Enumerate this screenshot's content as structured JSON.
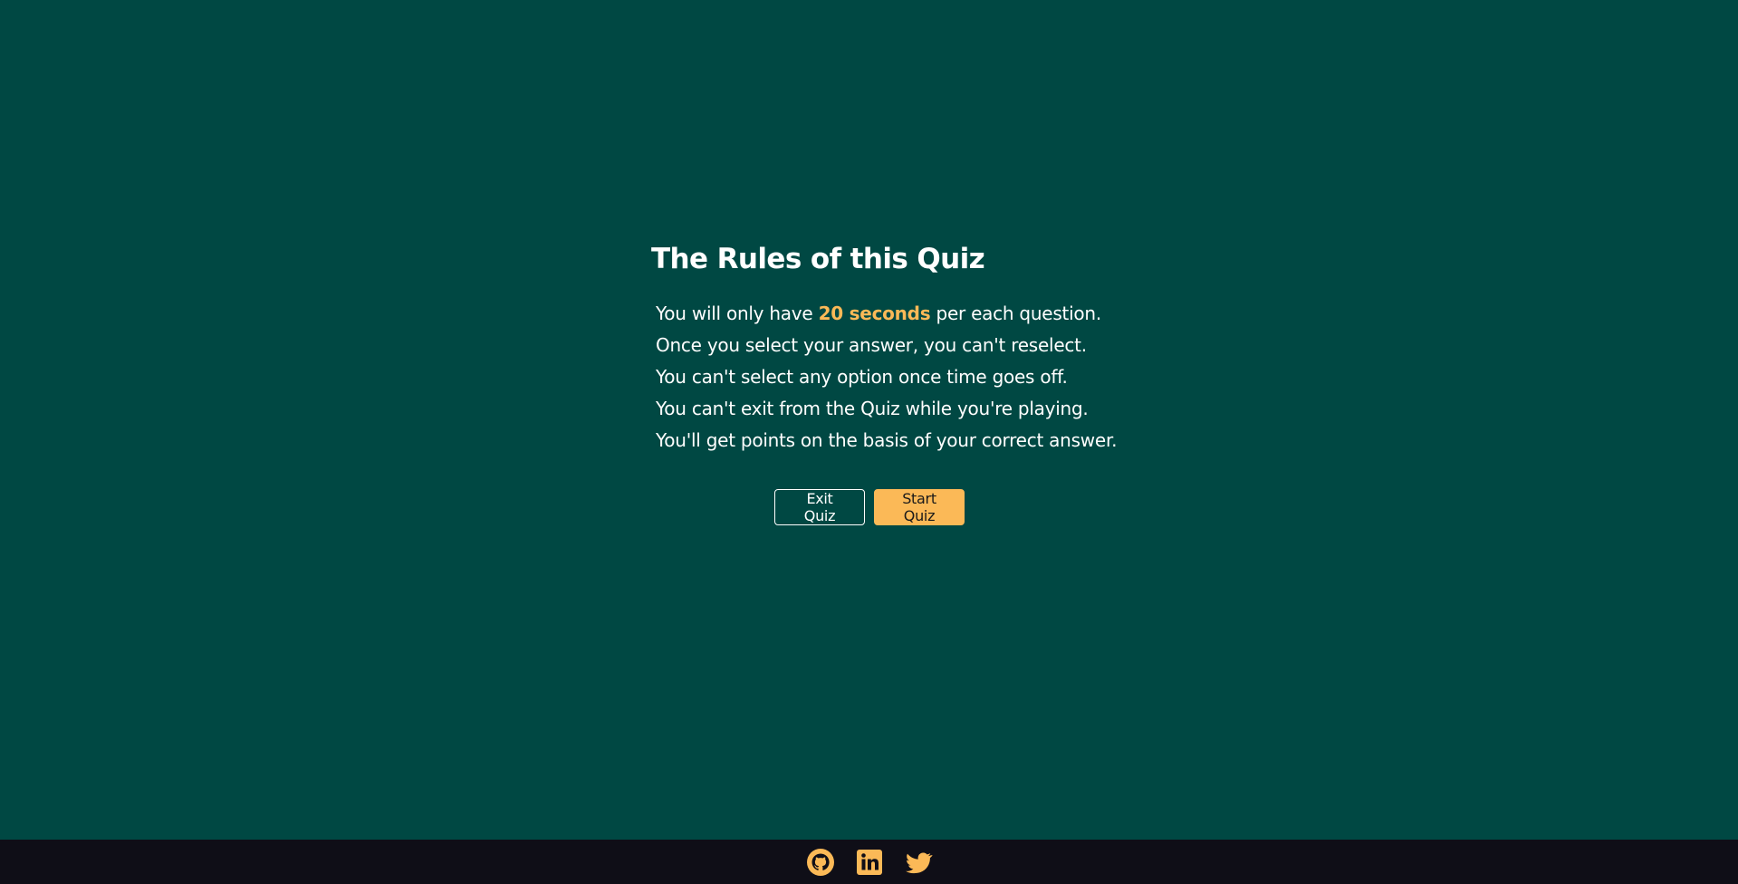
{
  "colors": {
    "background": "#004843",
    "footer": "#0f0e17",
    "accent": "#fbb957",
    "text": "#ffffff"
  },
  "rules": {
    "title": "The Rules of this Quiz",
    "items": [
      {
        "before": "You will only have ",
        "highlight": "20 seconds",
        "after": " per each question."
      },
      {
        "text": "Once you select your answer, you can't reselect."
      },
      {
        "text": "You can't select any option once time goes off."
      },
      {
        "text": "You can't exit from the Quiz while you're playing."
      },
      {
        "text": "You'll get points on the basis of your correct answer."
      }
    ]
  },
  "buttons": {
    "exit_label": "Exit Quiz",
    "start_label": "Start Quiz"
  },
  "footer": {
    "social": [
      {
        "icon": "github-icon"
      },
      {
        "icon": "linkedin-icon"
      },
      {
        "icon": "twitter-icon"
      }
    ]
  }
}
